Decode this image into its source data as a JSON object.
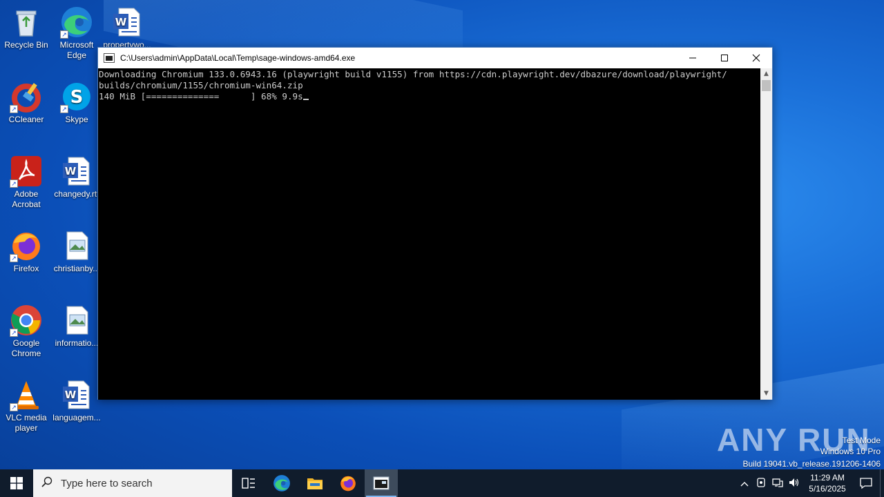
{
  "desktop": {
    "icons": [
      {
        "label": "Recycle Bin",
        "icon": "recycle-bin-icon"
      },
      {
        "label": "Microsoft Edge",
        "icon": "edge-icon"
      },
      {
        "label": "propertywo...",
        "icon": "word-document-icon"
      },
      {
        "label": "CCleaner",
        "icon": "ccleaner-icon"
      },
      {
        "label": "Skype",
        "icon": "skype-icon"
      },
      {
        "label": "Adobe Acrobat",
        "icon": "acrobat-icon"
      },
      {
        "label": "changedy.rtf",
        "icon": "word-document-icon"
      },
      {
        "label": "Firefox",
        "icon": "firefox-icon"
      },
      {
        "label": "christianby...",
        "icon": "image-file-icon"
      },
      {
        "label": "Google Chrome",
        "icon": "chrome-icon"
      },
      {
        "label": "informatio...",
        "icon": "image-file-icon"
      },
      {
        "label": "VLC media player",
        "icon": "vlc-icon"
      },
      {
        "label": "languagem...",
        "icon": "word-document-icon"
      }
    ]
  },
  "window": {
    "title": "C:\\Users\\admin\\AppData\\Local\\Temp\\sage-windows-amd64.exe",
    "buttons": {
      "minimize": "—",
      "maximize": "☐",
      "close": "✕"
    },
    "console_lines": [
      "Downloading Chromium 133.0.6943.16 (playwright build v1155) from https://cdn.playwright.dev/dbazure/download/playwright/",
      "builds/chromium/1155/chromium-win64.zip",
      "140 MiB [==============      ] 68% 9.9s"
    ],
    "download_progress_percent": 68
  },
  "watermark": {
    "brand": "ANY RUN",
    "test_mode": "Test Mode",
    "edition": "Windows 10 Pro",
    "build": "Build 19041.vb_release.191206-1406"
  },
  "taskbar": {
    "search_placeholder": "Type here to search",
    "apps": [
      "task-view-icon",
      "edge-icon",
      "file-explorer-icon",
      "firefox-icon",
      "console-icon"
    ],
    "clock": {
      "time": "11:29 AM",
      "date": "5/16/2025"
    },
    "colors": {
      "taskbar": "#101c2c",
      "active_indicator": "#7fb6f0"
    }
  }
}
